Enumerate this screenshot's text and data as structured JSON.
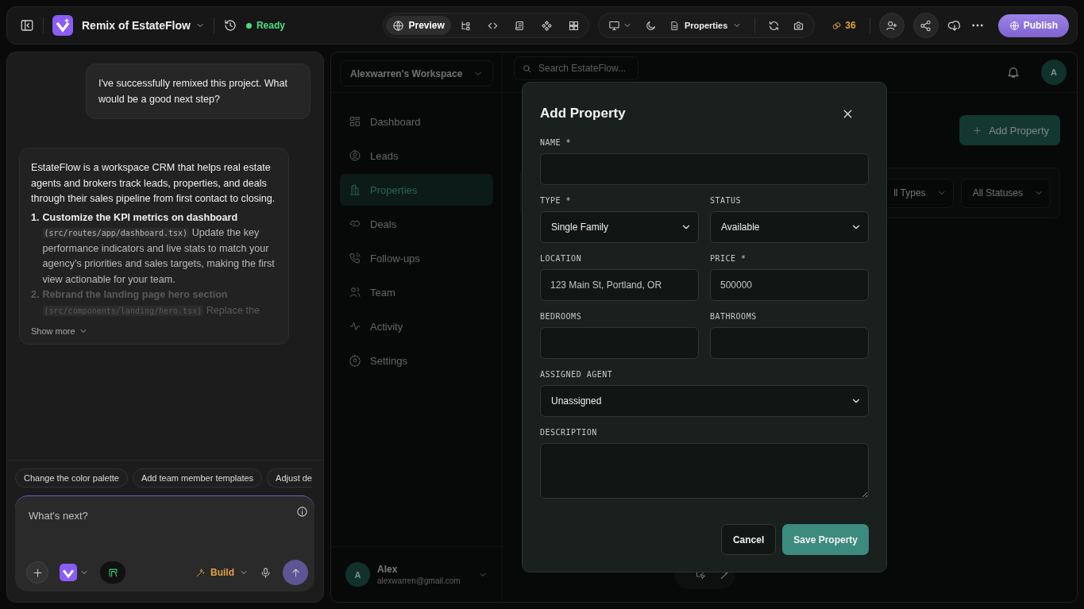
{
  "topbar": {
    "project_name": "Remix of EstateFlow",
    "status": "Ready",
    "view_tabs": [
      {
        "label": "Preview",
        "selected": true
      },
      {
        "selected": false
      },
      {
        "selected": false
      },
      {
        "selected": false
      },
      {
        "selected": false
      },
      {
        "selected": false
      }
    ],
    "page_selector": "Properties",
    "credits": "36",
    "publish": "Publish"
  },
  "chat": {
    "user_message": "I've successfully remixed this project. What would be a good next step?",
    "assistant": {
      "intro": "EstateFlow is a workspace CRM that helps real estate agents and brokers track leads, properties, and deals through their sales pipeline from first contact to closing.",
      "steps": [
        {
          "number": "1.",
          "title": "Customize the KPI metrics on dashboard",
          "path": "(src/routes/app/dashboard.tsx)",
          "body": "Update the key performance indicators and live stats to match your agency's priorities and sales targets, making the first view actionable for your team.",
          "faded": false
        },
        {
          "number": "2.",
          "title": "Rebrand the landing page hero section",
          "path": "(src/components/landing/hero.tsx)",
          "body": "Replace the",
          "faded": true
        }
      ],
      "show_more": "Show more"
    },
    "suggestions": [
      "Change the color palette",
      "Add team member templates",
      "Adjust de"
    ],
    "composer": {
      "placeholder": "What's next?",
      "mode": "Build"
    }
  },
  "app": {
    "workspace": "Alexwarren's Workspace",
    "nav": [
      {
        "label": "Dashboard",
        "selected": false
      },
      {
        "label": "Leads",
        "selected": false
      },
      {
        "label": "Properties",
        "selected": true
      },
      {
        "label": "Deals",
        "selected": false
      },
      {
        "label": "Follow-ups",
        "selected": false
      },
      {
        "label": "Team",
        "selected": false
      },
      {
        "label": "Activity",
        "selected": false
      },
      {
        "label": "Settings",
        "selected": false
      }
    ],
    "user": {
      "initial": "A",
      "name": "Alex",
      "email": "alexwarren@gmail.com"
    },
    "search": {
      "placeholder": "Search EstateFlow..."
    },
    "header_avatar": "A",
    "add_button": "Add Property",
    "filters": [
      "ll Types",
      "All Statuses"
    ]
  },
  "modal": {
    "title": "Add Property",
    "rows": [
      [
        {
          "kind": "text",
          "label": "NAME *"
        }
      ],
      [
        {
          "kind": "select",
          "label": "TYPE *",
          "value": "Single Family"
        },
        {
          "kind": "select",
          "label": "STATUS",
          "value": "Available"
        }
      ],
      [
        {
          "kind": "text",
          "label": "LOCATION",
          "placeholder": "123 Main St, Portland, OR"
        },
        {
          "kind": "text",
          "label": "PRICE *",
          "placeholder": "500000"
        }
      ],
      [
        {
          "kind": "text",
          "label": "BEDROOMS"
        },
        {
          "kind": "text",
          "label": "BATHROOMS"
        }
      ],
      [
        {
          "kind": "select",
          "label": "ASSIGNED AGENT",
          "value": "Unassigned"
        }
      ],
      [
        {
          "kind": "textarea",
          "label": "DESCRIPTION"
        }
      ]
    ],
    "cancel": "Cancel",
    "save": "Save Property"
  }
}
